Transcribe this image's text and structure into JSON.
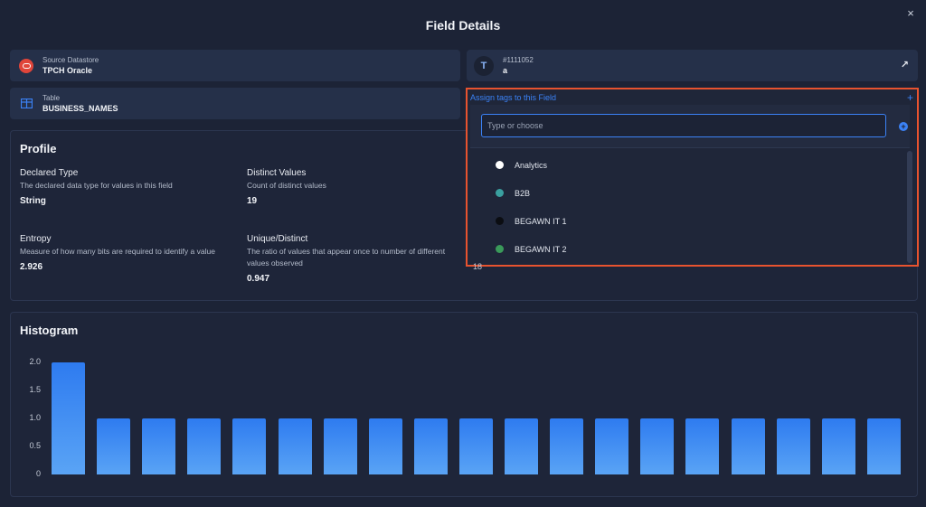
{
  "modal": {
    "title": "Field Details",
    "close_icon": "×"
  },
  "source_card": {
    "label": "Source Datastore",
    "value": "TPCH Oracle",
    "icon": "oracle-icon",
    "icon_color": "#e0453a"
  },
  "table_card": {
    "label": "Table",
    "value": "BUSINESS_NAMES",
    "icon": "table-icon",
    "icon_color": "#3b82f6"
  },
  "field_card": {
    "label": "#1111052",
    "value": "a",
    "icon": "text-field-icon",
    "link_icon": "↗"
  },
  "tags": {
    "header": "Assign tags to this Field",
    "plus": "+",
    "placeholder": "Type or choose",
    "items": [
      {
        "label": "Analytics",
        "color": "#ffffff"
      },
      {
        "label": "B2B",
        "color": "#3aa0a0"
      },
      {
        "label": "BEGAWN IT 1",
        "color": "#0b0d12"
      },
      {
        "label": "BEGAWN IT 2",
        "color": "#3a9a5a"
      }
    ],
    "partial_value_below": "18"
  },
  "profile": {
    "title": "Profile",
    "declared_type": {
      "name": "Declared Type",
      "desc": "The declared data type for values in this field",
      "value": "String"
    },
    "distinct_values": {
      "name": "Distinct Values",
      "desc": "Count of distinct values",
      "value": "19"
    },
    "entropy": {
      "name": "Entropy",
      "desc": "Measure of how many bits are required to identify a value",
      "value": "2.926"
    },
    "unique_distinct": {
      "name": "Unique/Distinct",
      "desc": "The ratio of values that appear once to number of different values observed",
      "value": "0.947"
    }
  },
  "histogram": {
    "title": "Histogram"
  },
  "chart_data": {
    "type": "bar",
    "title": "Histogram",
    "yticks": [
      "2.0",
      "1.5",
      "1.0",
      "0.5",
      "0"
    ],
    "ylim": [
      0,
      2.0
    ],
    "values": [
      2,
      1,
      1,
      1,
      1,
      1,
      1,
      1,
      1,
      1,
      1,
      1,
      1,
      1,
      1,
      1,
      1,
      1,
      1
    ],
    "bar_color": "#3b82f6"
  }
}
